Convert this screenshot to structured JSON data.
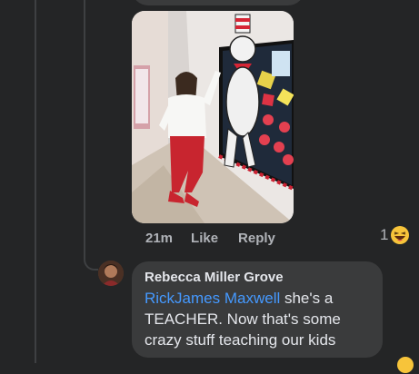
{
  "comment": {
    "time": "21m",
    "like_label": "Like",
    "reply_label": "Reply",
    "reaction_count": "1",
    "reaction_icon": "laughing-emoji-icon"
  },
  "reply": {
    "author": "Rebecca Miller Grove",
    "mention": "RickJames Maxwell",
    "text_line1_rest": " she's a",
    "text_line2": "TEACHER. Now that's some",
    "text_line3": "crazy stuff teaching our kids"
  },
  "colors": {
    "background": "#242526",
    "bubble": "#3a3b3c",
    "mention": "#4599ff",
    "meta_text": "#b0b3b8"
  }
}
